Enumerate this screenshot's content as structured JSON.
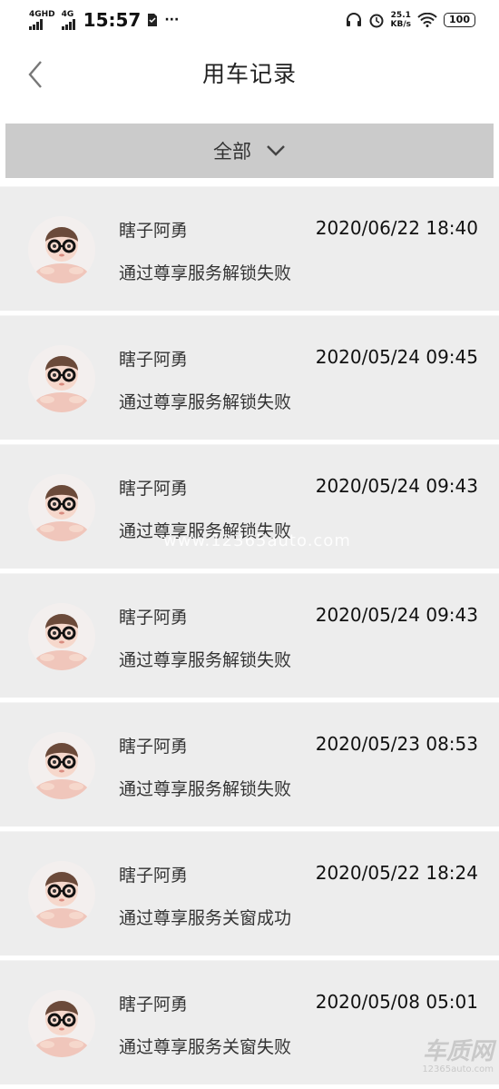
{
  "status_bar": {
    "network_1": "4GHD",
    "network_2": "4G",
    "time": "15:57",
    "more": "···",
    "speed_value": "25.1",
    "speed_unit": "KB/s",
    "battery": "100"
  },
  "header": {
    "title": "用车记录"
  },
  "filter": {
    "label": "全部"
  },
  "records": [
    {
      "name": "瞎子阿勇",
      "time": "2020/06/22 18:40",
      "desc": "通过尊享服务解锁失败"
    },
    {
      "name": "瞎子阿勇",
      "time": "2020/05/24 09:45",
      "desc": "通过尊享服务解锁失败"
    },
    {
      "name": "瞎子阿勇",
      "time": "2020/05/24 09:43",
      "desc": "通过尊享服务解锁失败"
    },
    {
      "name": "瞎子阿勇",
      "time": "2020/05/24 09:43",
      "desc": "通过尊享服务解锁失败"
    },
    {
      "name": "瞎子阿勇",
      "time": "2020/05/23 08:53",
      "desc": "通过尊享服务解锁失败"
    },
    {
      "name": "瞎子阿勇",
      "time": "2020/05/22 18:24",
      "desc": "通过尊享服务关窗成功"
    },
    {
      "name": "瞎子阿勇",
      "time": "2020/05/08 05:01",
      "desc": "通过尊享服务关窗失败"
    }
  ],
  "watermark": "www.12365auto.com",
  "logo": {
    "title": "车质网",
    "url": "12365auto.com"
  }
}
